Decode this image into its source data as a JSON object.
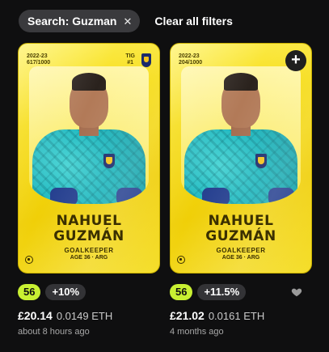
{
  "filters": {
    "search_chip": "Search: Guzman",
    "clear_label": "Clear all filters"
  },
  "cards": [
    {
      "season": "2022-23",
      "serial": "617/1000",
      "team_code": "TIG",
      "team_rank": "#1",
      "first_name": "NAHUEL",
      "last_name": "GUZMÁN",
      "position": "GOALKEEPER",
      "age_nat": "AGE 36 · ARG",
      "score": "56",
      "delta": "+10%",
      "price_gbp": "£20.14",
      "price_eth": "0.0149 ETH",
      "listed": "about 8 hours ago"
    },
    {
      "season": "2022-23",
      "serial": "204/1000",
      "first_name": "NAHUEL",
      "last_name": "GUZMÁN",
      "position": "GOALKEEPER",
      "age_nat": "AGE 36 · ARG",
      "add_label": "+",
      "score": "56",
      "delta": "+11.5%",
      "price_gbp": "£21.02",
      "price_eth": "0.0161 ETH",
      "listed": "4 months ago"
    }
  ],
  "colors": {
    "background": "#0f0f10",
    "card_yellow": "#f0cf08",
    "score_green": "#c8f032"
  }
}
